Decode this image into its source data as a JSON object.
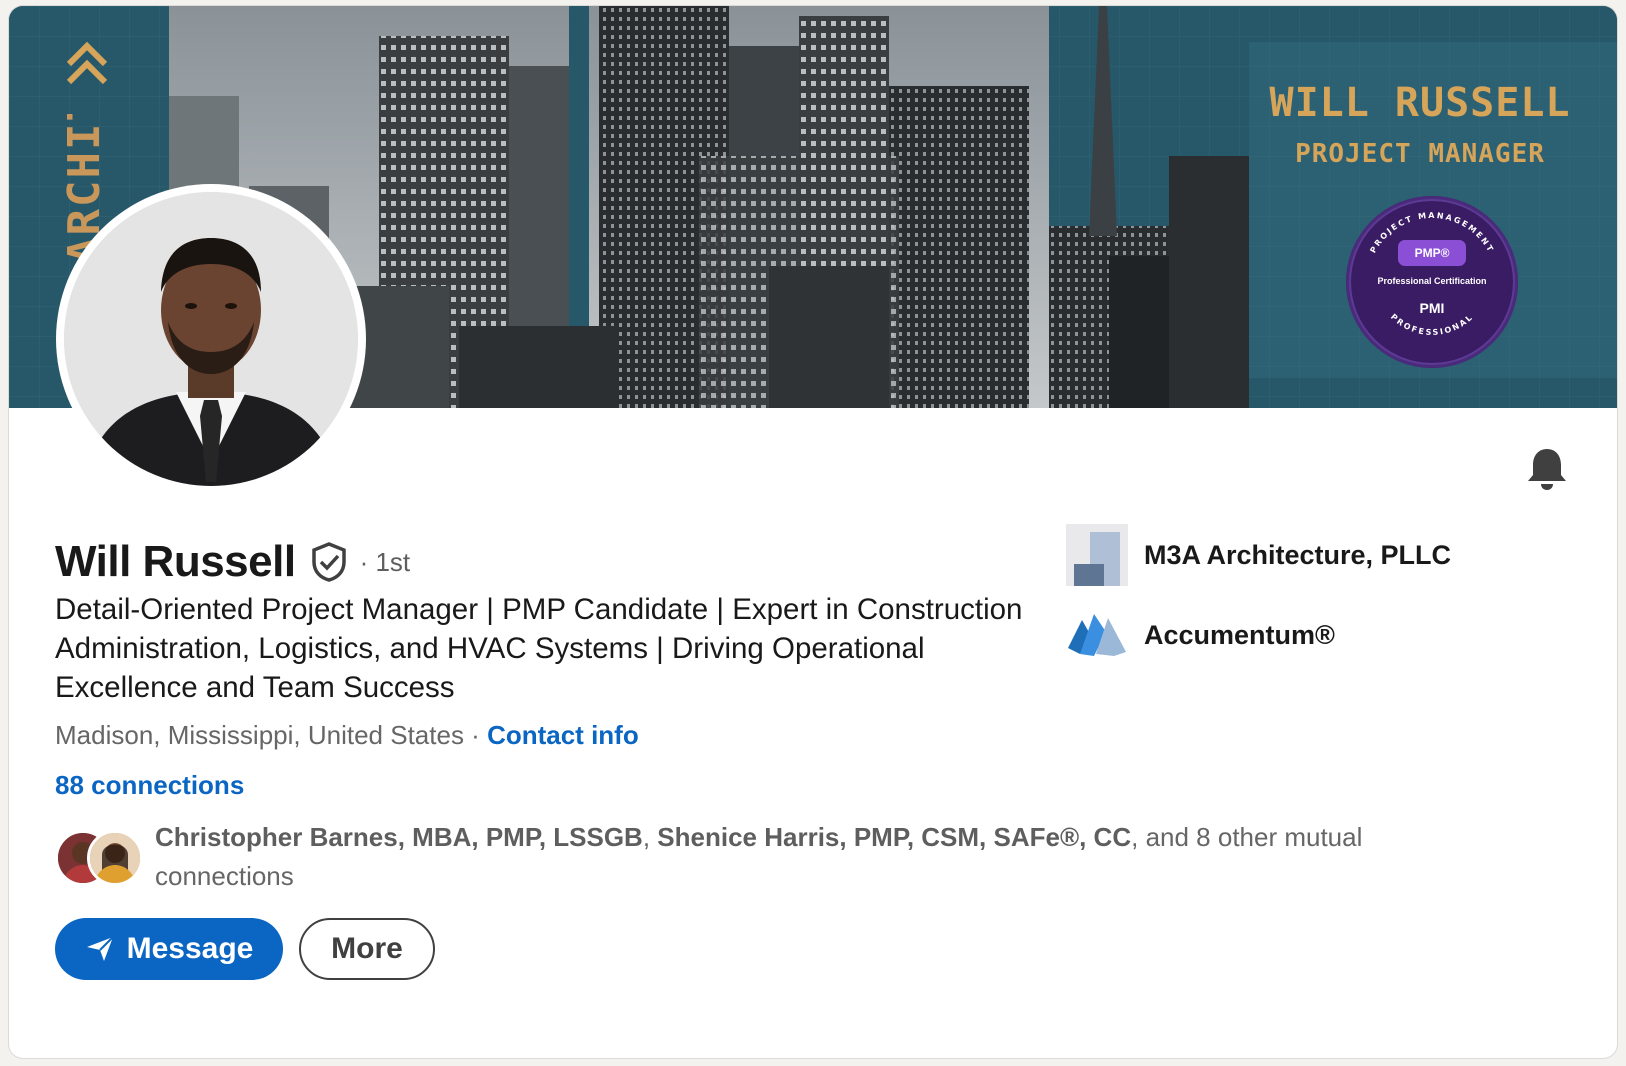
{
  "banner": {
    "name": "WILL RUSSELL",
    "role": "PROJECT MANAGER",
    "vertical_text": "ARCHITECTURE",
    "badge": {
      "ring_top": "PROJECT MANAGEMENT",
      "ring_bottom": "PROFESSIONAL",
      "pill": "PMP®",
      "caption": "Professional Certification",
      "logo": "PMI"
    },
    "colors": {
      "teal": "#27586a",
      "gold": "#d6a55a",
      "badge": "#3a1c64"
    }
  },
  "profile": {
    "name": "Will Russell",
    "verified_icon": "verified-shield-icon",
    "degree": "· 1st",
    "headline": "Detail-Oriented Project Manager | PMP Candidate | Expert in Construction Administration, Logistics, and HVAC Systems | Driving Operational Excellence and Team Success",
    "location": "Madison, Mississippi, United States",
    "separator": " · ",
    "contact_info": "Contact info",
    "connections": "88 connections"
  },
  "mutual": {
    "person1": "Christopher Barnes, MBA, PMP, LSSGB",
    "sep": ", ",
    "person2": "Shenice Harris, PMP, CSM, SAFe®, CC",
    "rest": ", and 8 other mutual connections"
  },
  "actions": {
    "message": "Message",
    "more": "More"
  },
  "experience": [
    {
      "name": "M3A Architecture, PLLC",
      "icon": "company-logo-icon"
    },
    {
      "name": "Accumentum®",
      "icon": "accumentum-logo-icon"
    }
  ],
  "notifications": {
    "icon": "bell-icon"
  },
  "accent_color": "#0a66c2"
}
